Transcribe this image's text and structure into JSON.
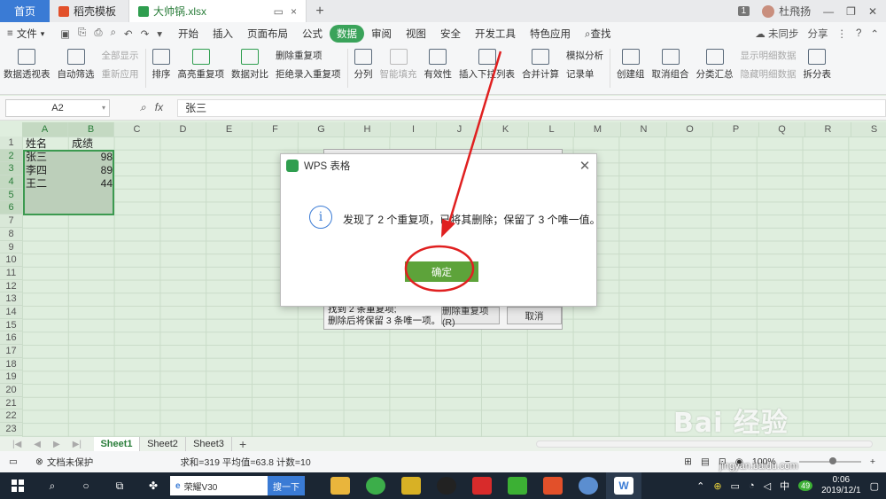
{
  "titlebar": {
    "home_tab": "首页",
    "tabs": [
      {
        "label": "稻壳模板"
      },
      {
        "label": "大帅锅.xlsx"
      }
    ],
    "badge": "1",
    "user": "杜飛扬"
  },
  "menubar": {
    "file": "文件",
    "items": [
      "开始",
      "插入",
      "页面布局",
      "公式",
      "数据",
      "审阅",
      "视图",
      "安全",
      "开发工具",
      "特色应用"
    ],
    "active": "数据",
    "search": "查找",
    "sync": "未同步",
    "share": "分享"
  },
  "ribbon": {
    "pivot": "数据透视表",
    "autofilter": "自动筛选",
    "show_all": "全部显示",
    "reapply": "重新应用",
    "sort": "排序",
    "highlight_dup": "高亮重复项",
    "delete_dup": "删除重复项",
    "reject_dup": "拒绝录入重复项",
    "compare": "数据对比",
    "split": "分列",
    "smart_fill": "智能填充",
    "validity": "有效性",
    "dropdown": "插入下拉列表",
    "consolidate": "合并计算",
    "simulate": "模拟分析",
    "record": "记录单",
    "group": "创建组",
    "ungroup": "取消组合",
    "subtotal": "分类汇总",
    "show_detail": "显示明细数据",
    "hide_detail": "隐藏明细数据",
    "split_table": "拆分表"
  },
  "formula_bar": {
    "cell_ref": "A2",
    "fx": "fx",
    "value": "张三"
  },
  "grid": {
    "columns": [
      "A",
      "B",
      "C",
      "D",
      "E",
      "F",
      "G",
      "H",
      "I",
      "J",
      "K",
      "L",
      "M",
      "N",
      "O",
      "P",
      "Q",
      "R",
      "S"
    ],
    "rows": [
      "1",
      "2",
      "3",
      "4",
      "5",
      "6",
      "7",
      "8",
      "9",
      "10",
      "11",
      "12",
      "13",
      "14",
      "15",
      "16",
      "17",
      "18",
      "19",
      "20",
      "21",
      "22",
      "23"
    ],
    "header": [
      "姓名",
      "成绩"
    ],
    "data": [
      {
        "name": "张三",
        "score": "98"
      },
      {
        "name": "李四",
        "score": "89"
      },
      {
        "name": "王二",
        "score": "44"
      }
    ]
  },
  "bg_dialog": {
    "line1": "找到 2 条重复项;",
    "line2": "删除后将保留 3 条唯一项。",
    "delete_btn": "删除重复项(R)",
    "cancel_btn": "取消"
  },
  "modal": {
    "title": "WPS 表格",
    "message": "发现了 2 个重复项，已将其删除；保留了 3 个唯一值。",
    "ok": "确定"
  },
  "sheets": [
    "Sheet1",
    "Sheet2",
    "Sheet3"
  ],
  "status": {
    "protect": "文档未保护",
    "sum": "求和=319  平均值=63.8  计数=10",
    "zoom": "100%"
  },
  "taskbar": {
    "search_text": "荣耀V30",
    "search_btn": "搜一下",
    "ime": "中",
    "notif": "49",
    "time": "0:06",
    "date": "2019/12/1"
  },
  "watermark": {
    "brand": "Bai 经验",
    "url": "jingyan.baidu.com"
  },
  "colors": {
    "accent": "#3aa35a",
    "annotation": "#e02020",
    "ok_button": "#5da33a",
    "grid_bg": "#dfeede"
  }
}
